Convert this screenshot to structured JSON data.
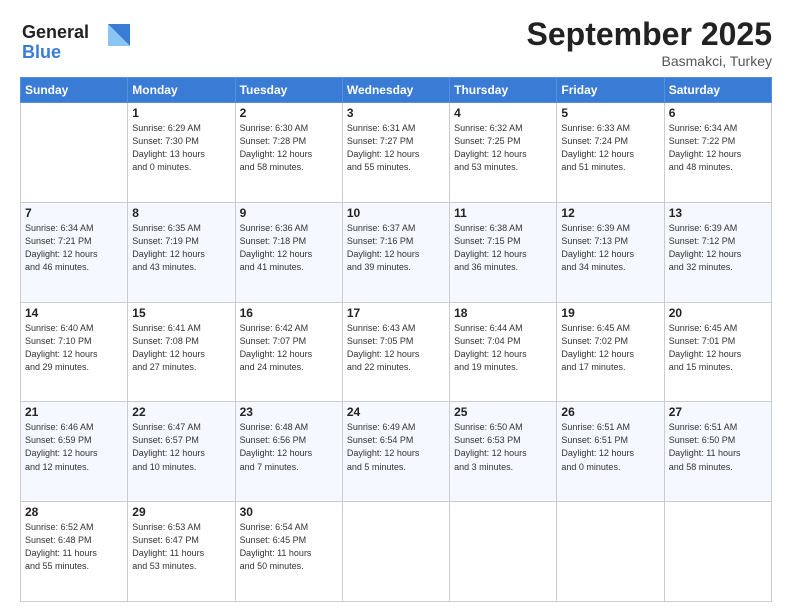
{
  "header": {
    "logo_line1": "General",
    "logo_line2": "Blue",
    "month": "September 2025",
    "location": "Basmakci, Turkey"
  },
  "days_of_week": [
    "Sunday",
    "Monday",
    "Tuesday",
    "Wednesday",
    "Thursday",
    "Friday",
    "Saturday"
  ],
  "weeks": [
    [
      {
        "day": "",
        "info": ""
      },
      {
        "day": "1",
        "info": "Sunrise: 6:29 AM\nSunset: 7:30 PM\nDaylight: 13 hours\nand 0 minutes."
      },
      {
        "day": "2",
        "info": "Sunrise: 6:30 AM\nSunset: 7:28 PM\nDaylight: 12 hours\nand 58 minutes."
      },
      {
        "day": "3",
        "info": "Sunrise: 6:31 AM\nSunset: 7:27 PM\nDaylight: 12 hours\nand 55 minutes."
      },
      {
        "day": "4",
        "info": "Sunrise: 6:32 AM\nSunset: 7:25 PM\nDaylight: 12 hours\nand 53 minutes."
      },
      {
        "day": "5",
        "info": "Sunrise: 6:33 AM\nSunset: 7:24 PM\nDaylight: 12 hours\nand 51 minutes."
      },
      {
        "day": "6",
        "info": "Sunrise: 6:34 AM\nSunset: 7:22 PM\nDaylight: 12 hours\nand 48 minutes."
      }
    ],
    [
      {
        "day": "7",
        "info": "Sunrise: 6:34 AM\nSunset: 7:21 PM\nDaylight: 12 hours\nand 46 minutes."
      },
      {
        "day": "8",
        "info": "Sunrise: 6:35 AM\nSunset: 7:19 PM\nDaylight: 12 hours\nand 43 minutes."
      },
      {
        "day": "9",
        "info": "Sunrise: 6:36 AM\nSunset: 7:18 PM\nDaylight: 12 hours\nand 41 minutes."
      },
      {
        "day": "10",
        "info": "Sunrise: 6:37 AM\nSunset: 7:16 PM\nDaylight: 12 hours\nand 39 minutes."
      },
      {
        "day": "11",
        "info": "Sunrise: 6:38 AM\nSunset: 7:15 PM\nDaylight: 12 hours\nand 36 minutes."
      },
      {
        "day": "12",
        "info": "Sunrise: 6:39 AM\nSunset: 7:13 PM\nDaylight: 12 hours\nand 34 minutes."
      },
      {
        "day": "13",
        "info": "Sunrise: 6:39 AM\nSunset: 7:12 PM\nDaylight: 12 hours\nand 32 minutes."
      }
    ],
    [
      {
        "day": "14",
        "info": "Sunrise: 6:40 AM\nSunset: 7:10 PM\nDaylight: 12 hours\nand 29 minutes."
      },
      {
        "day": "15",
        "info": "Sunrise: 6:41 AM\nSunset: 7:08 PM\nDaylight: 12 hours\nand 27 minutes."
      },
      {
        "day": "16",
        "info": "Sunrise: 6:42 AM\nSunset: 7:07 PM\nDaylight: 12 hours\nand 24 minutes."
      },
      {
        "day": "17",
        "info": "Sunrise: 6:43 AM\nSunset: 7:05 PM\nDaylight: 12 hours\nand 22 minutes."
      },
      {
        "day": "18",
        "info": "Sunrise: 6:44 AM\nSunset: 7:04 PM\nDaylight: 12 hours\nand 19 minutes."
      },
      {
        "day": "19",
        "info": "Sunrise: 6:45 AM\nSunset: 7:02 PM\nDaylight: 12 hours\nand 17 minutes."
      },
      {
        "day": "20",
        "info": "Sunrise: 6:45 AM\nSunset: 7:01 PM\nDaylight: 12 hours\nand 15 minutes."
      }
    ],
    [
      {
        "day": "21",
        "info": "Sunrise: 6:46 AM\nSunset: 6:59 PM\nDaylight: 12 hours\nand 12 minutes."
      },
      {
        "day": "22",
        "info": "Sunrise: 6:47 AM\nSunset: 6:57 PM\nDaylight: 12 hours\nand 10 minutes."
      },
      {
        "day": "23",
        "info": "Sunrise: 6:48 AM\nSunset: 6:56 PM\nDaylight: 12 hours\nand 7 minutes."
      },
      {
        "day": "24",
        "info": "Sunrise: 6:49 AM\nSunset: 6:54 PM\nDaylight: 12 hours\nand 5 minutes."
      },
      {
        "day": "25",
        "info": "Sunrise: 6:50 AM\nSunset: 6:53 PM\nDaylight: 12 hours\nand 3 minutes."
      },
      {
        "day": "26",
        "info": "Sunrise: 6:51 AM\nSunset: 6:51 PM\nDaylight: 12 hours\nand 0 minutes."
      },
      {
        "day": "27",
        "info": "Sunrise: 6:51 AM\nSunset: 6:50 PM\nDaylight: 11 hours\nand 58 minutes."
      }
    ],
    [
      {
        "day": "28",
        "info": "Sunrise: 6:52 AM\nSunset: 6:48 PM\nDaylight: 11 hours\nand 55 minutes."
      },
      {
        "day": "29",
        "info": "Sunrise: 6:53 AM\nSunset: 6:47 PM\nDaylight: 11 hours\nand 53 minutes."
      },
      {
        "day": "30",
        "info": "Sunrise: 6:54 AM\nSunset: 6:45 PM\nDaylight: 11 hours\nand 50 minutes."
      },
      {
        "day": "",
        "info": ""
      },
      {
        "day": "",
        "info": ""
      },
      {
        "day": "",
        "info": ""
      },
      {
        "day": "",
        "info": ""
      }
    ]
  ]
}
